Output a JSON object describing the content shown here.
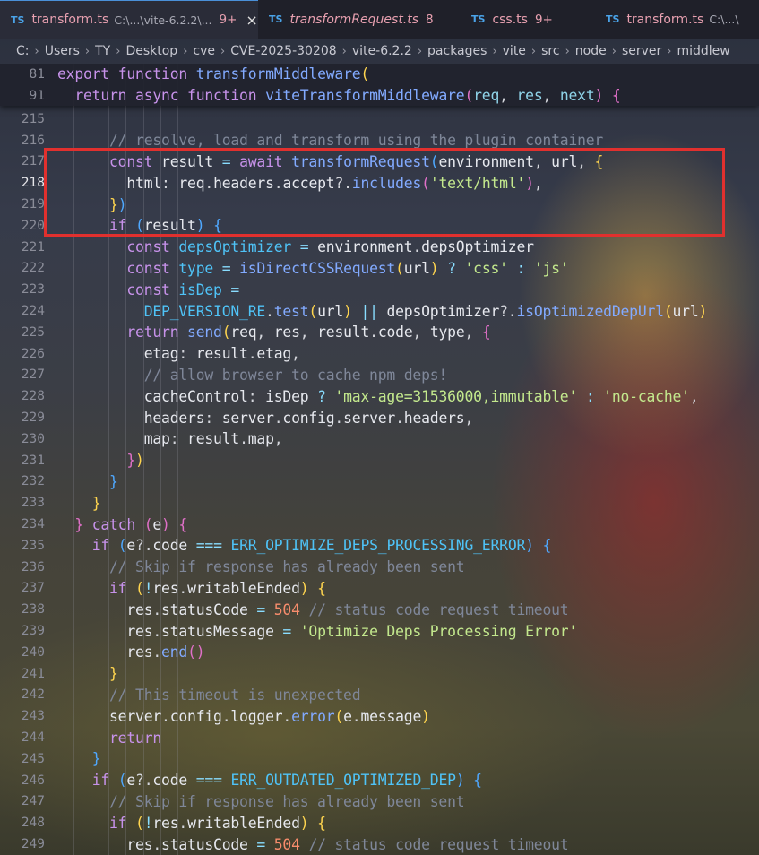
{
  "tabs": [
    {
      "lang": "TS",
      "name": "transform.ts",
      "path": "C:\\...\\vite-6.2.2\\...",
      "count": "9+",
      "close": "×",
      "active": true,
      "italic": false
    },
    {
      "lang": "TS",
      "name": "transformRequest.ts",
      "path": "",
      "count": "8",
      "close": "",
      "active": false,
      "italic": true
    },
    {
      "lang": "TS",
      "name": "css.ts",
      "path": "",
      "count": "9+",
      "close": "",
      "active": false,
      "italic": false
    },
    {
      "lang": "TS",
      "name": "transform.ts",
      "path": "C:\\...\\",
      "count": "",
      "close": "",
      "active": false,
      "italic": false
    }
  ],
  "breadcrumbs": [
    "C:",
    "Users",
    "TY",
    "Desktop",
    "cve",
    "CVE-2025-30208",
    "vite-6.2.2",
    "packages",
    "vite",
    "src",
    "node",
    "server",
    "middlew"
  ],
  "sticky": [
    {
      "num": "81",
      "html": "<span class='k'>export</span> <span class='k'>function</span> <span class='f'>transformMiddleware</span><span class='b1'>(</span>"
    },
    {
      "num": "91",
      "html": "  <span class='k'>return</span> <span class='k'>async</span> <span class='k'>function</span> <span class='f'>viteTransformMiddleware</span><span class='b2'>(</span><span class='p'>req</span>, <span class='p'>res</span>, <span class='p'>next</span><span class='b2'>)</span> <span class='b2'>{</span>"
    }
  ],
  "lines": [
    {
      "num": "215",
      "html": ""
    },
    {
      "num": "216",
      "html": "      <span class='c'>// resolve, load and transform using the plugin container</span>"
    },
    {
      "num": "217",
      "html": "      <span class='k'>const</span> <span class='v'>result</span> <span class='op'>=</span> <span class='k'>await</span> <span class='f'>transformRequest</span><span class='b3'>(</span><span class='v'>environment</span>, <span class='v'>url</span>, <span class='b1'>{</span>"
    },
    {
      "num": "218",
      "html": "        <span class='v'>html</span>: <span class='v'>req</span>.<span class='v'>headers</span>.<span class='v'>accept</span>?.<span class='f'>includes</span><span class='b2'>(</span><span class='s'>'text/html'</span><span class='b2'>)</span>,",
      "current": true
    },
    {
      "num": "219",
      "html": "      <span class='b1'>}</span><span class='b3'>)</span>"
    },
    {
      "num": "220",
      "html": "      <span class='k'>if</span> <span class='b3'>(</span><span class='v'>result</span><span class='b3'>)</span> <span class='b3'>{</span>"
    },
    {
      "num": "221",
      "html": "        <span class='k'>const</span> <span class='cn'>depsOptimizer</span> <span class='op'>=</span> <span class='v'>environment</span>.<span class='v'>depsOptimizer</span>"
    },
    {
      "num": "222",
      "html": "        <span class='k'>const</span> <span class='cn'>type</span> <span class='op'>=</span> <span class='f'>isDirectCSSRequest</span><span class='b1'>(</span><span class='v'>url</span><span class='b1'>)</span> <span class='op'>?</span> <span class='s'>'css'</span> <span class='op'>:</span> <span class='s'>'js'</span>"
    },
    {
      "num": "223",
      "html": "        <span class='k'>const</span> <span class='cn'>isDep</span> <span class='op'>=</span>"
    },
    {
      "num": "224",
      "html": "          <span class='cn'>DEP_VERSION_RE</span>.<span class='f'>test</span><span class='b1'>(</span><span class='v'>url</span><span class='b1'>)</span> <span class='op'>||</span> <span class='v'>depsOptimizer</span>?.<span class='f'>isOptimizedDepUrl</span><span class='b1'>(</span><span class='v'>url</span><span class='b1'>)</span>"
    },
    {
      "num": "225",
      "html": "        <span class='k'>return</span> <span class='f'>send</span><span class='b1'>(</span><span class='v'>req</span>, <span class='v'>res</span>, <span class='v'>result</span>.<span class='v'>code</span>, <span class='v'>type</span>, <span class='b2'>{</span>"
    },
    {
      "num": "226",
      "html": "          <span class='v'>etag</span>: <span class='v'>result</span>.<span class='v'>etag</span>,"
    },
    {
      "num": "227",
      "html": "          <span class='c'>// allow browser to cache npm deps!</span>"
    },
    {
      "num": "228",
      "html": "          <span class='v'>cacheControl</span>: <span class='v'>isDep</span> <span class='op'>?</span> <span class='s'>'max-age=31536000,immutable'</span> <span class='op'>:</span> <span class='s'>'no-cache'</span>,"
    },
    {
      "num": "229",
      "html": "          <span class='v'>headers</span>: <span class='v'>server</span>.<span class='v'>config</span>.<span class='v'>server</span>.<span class='v'>headers</span>,"
    },
    {
      "num": "230",
      "html": "          <span class='v'>map</span>: <span class='v'>result</span>.<span class='v'>map</span>,"
    },
    {
      "num": "231",
      "html": "        <span class='b2'>}</span><span class='b1'>)</span>"
    },
    {
      "num": "232",
      "html": "      <span class='b3'>}</span>"
    },
    {
      "num": "233",
      "html": "    <span class='b1'>}</span>"
    },
    {
      "num": "234",
      "html": "  <span class='b2'>}</span> <span class='k'>catch</span> <span class='b2'>(</span><span class='v'>e</span><span class='b2'>)</span> <span class='b2'>{</span>"
    },
    {
      "num": "235",
      "html": "    <span class='k'>if</span> <span class='b3'>(</span><span class='v'>e</span>?.<span class='v'>code</span> <span class='op'>===</span> <span class='cn'>ERR_OPTIMIZE_DEPS_PROCESSING_ERROR</span><span class='b3'>)</span> <span class='b3'>{</span>"
    },
    {
      "num": "236",
      "html": "      <span class='c'>// Skip if response has already been sent</span>"
    },
    {
      "num": "237",
      "html": "      <span class='k'>if</span> <span class='b1'>(</span><span class='op'>!</span><span class='v'>res</span>.<span class='v'>writableEnded</span><span class='b1'>)</span> <span class='b1'>{</span>"
    },
    {
      "num": "238",
      "html": "        <span class='v'>res</span>.<span class='v'>statusCode</span> <span class='op'>=</span> <span class='n'>504</span> <span class='c'>// status code request timeout</span>"
    },
    {
      "num": "239",
      "html": "        <span class='v'>res</span>.<span class='v'>statusMessage</span> <span class='op'>=</span> <span class='s'>'Optimize Deps Processing Error'</span>"
    },
    {
      "num": "240",
      "html": "        <span class='v'>res</span>.<span class='f'>end</span><span class='b2'>()</span>"
    },
    {
      "num": "241",
      "html": "      <span class='b1'>}</span>"
    },
    {
      "num": "242",
      "html": "      <span class='c'>// This timeout is unexpected</span>"
    },
    {
      "num": "243",
      "html": "      <span class='v'>server</span>.<span class='v'>config</span>.<span class='v'>logger</span>.<span class='f'>error</span><span class='b1'>(</span><span class='v'>e</span>.<span class='v'>message</span><span class='b1'>)</span>"
    },
    {
      "num": "244",
      "html": "      <span class='k'>return</span>"
    },
    {
      "num": "245",
      "html": "    <span class='b3'>}</span>"
    },
    {
      "num": "246",
      "html": "    <span class='k'>if</span> <span class='b3'>(</span><span class='v'>e</span>?.<span class='v'>code</span> <span class='op'>===</span> <span class='cn'>ERR_OUTDATED_OPTIMIZED_DEP</span><span class='b3'>)</span> <span class='b3'>{</span>"
    },
    {
      "num": "247",
      "html": "      <span class='c'>// Skip if response has already been sent</span>"
    },
    {
      "num": "248",
      "html": "      <span class='k'>if</span> <span class='b1'>(</span><span class='op'>!</span><span class='v'>res</span>.<span class='v'>writableEnded</span><span class='b1'>)</span> <span class='b1'>{</span>"
    },
    {
      "num": "249",
      "html": "        <span class='v'>res</span>.<span class='v'>statusCode</span> <span class='op'>=</span> <span class='n'>504</span> <span class='c'>// status code request timeout</span>"
    }
  ]
}
